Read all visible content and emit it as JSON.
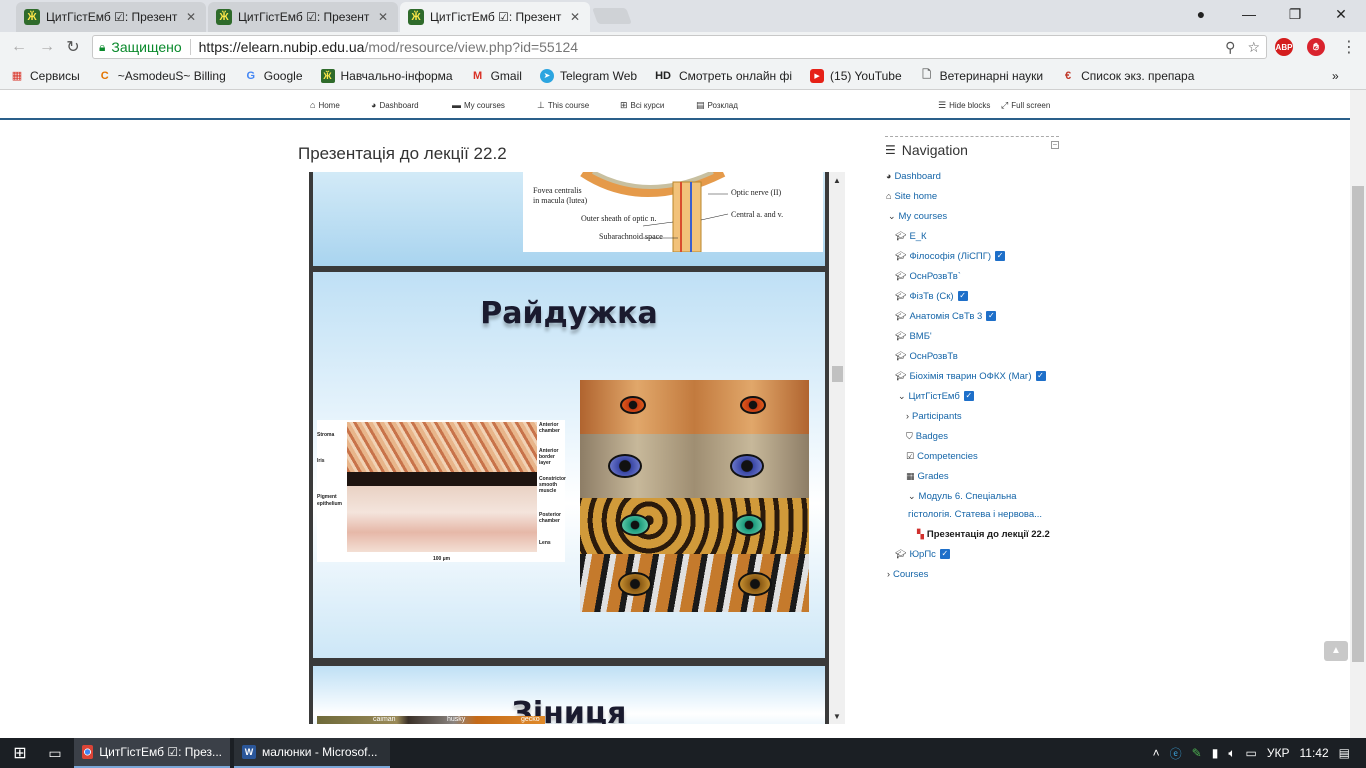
{
  "browser": {
    "tabs": [
      {
        "title": "ЦитГістЕмб ☑: Презент",
        "close": "✕"
      },
      {
        "title": "ЦитГістЕмб ☑: Презент",
        "close": "✕"
      },
      {
        "title": "ЦитГістЕмб ☑: Презент",
        "close": "✕"
      }
    ],
    "window_controls": {
      "minimize": "—",
      "restore": "❐",
      "close": "✕"
    },
    "address": {
      "secure_label": "Защищено",
      "url_scheme_host": "https://elearn.nubip.edu.ua",
      "url_path": "/mod/resource/view.php?id=55124"
    },
    "bookmarks": [
      {
        "label": "Сервисы"
      },
      {
        "label": "~AsmodeuS~ Billing"
      },
      {
        "label": "Google"
      },
      {
        "label": "Навчально-інформа"
      },
      {
        "label": "Gmail"
      },
      {
        "label": "Telegram Web"
      },
      {
        "label": "Смотреть онлайн фі"
      },
      {
        "label": "(15) YouTube"
      },
      {
        "label": "Ветеринарні науки"
      },
      {
        "label": "Список экз. препара"
      }
    ],
    "bookmark_prefixes": {
      "hd": "HD"
    },
    "extensions": {
      "abp": "ABP"
    },
    "more": "»"
  },
  "moodle_nav": {
    "home": "Home",
    "dashboard": "Dashboard",
    "my_courses": "My courses",
    "this_course": "This course",
    "all_courses": "Всі курси",
    "schedule": "Розклад",
    "hide_blocks": "Hide blocks",
    "full_screen": "Full screen"
  },
  "page": {
    "title": "Презентація до лекції 22.2"
  },
  "slides": {
    "slide1_labels": {
      "fovea": "Fovea centralis",
      "macula": "in macula (lutea)",
      "optic_nerve": "Optic nerve (II)",
      "outer_sheath": "Outer sheath of optic n.",
      "central": "Central a. and v.",
      "subarachnoid": "Subarachnoid space"
    },
    "slide2_heading": "Райдужка",
    "histo_labels": {
      "stroma": "Stroma",
      "iris": "Iris",
      "pigment": "Pigment",
      "epithelium": "epithelium",
      "anterior_chamber": "Anterior chamber",
      "anterior_border": "Anterior border layer",
      "constrictor": "Constrictor smooth muscle",
      "posterior": "Posterior chamber",
      "lens": "Lens",
      "scale": "100 µm"
    },
    "slide3_heading": "Зіниця",
    "slide3_labels": {
      "caiman": "caiman",
      "husky": "husky",
      "gecko": "gecko"
    }
  },
  "navigation": {
    "header": "Navigation",
    "items": [
      {
        "label": "Dashboard"
      },
      {
        "label": "Site home"
      },
      {
        "label": "My courses"
      },
      {
        "label": "Е_К"
      },
      {
        "label": "Філософія (ЛіСПГ)"
      },
      {
        "label": "ОснРозвТв`"
      },
      {
        "label": "ФізТв (Ск)"
      },
      {
        "label": "Анатомія СвТв 3"
      },
      {
        "label": "ВМБ'"
      },
      {
        "label": "ОснРозвТв"
      },
      {
        "label": "Біохімія тварин ОФКХ (Маг)"
      },
      {
        "label": "ЦитГістЕмб"
      },
      {
        "label": "Participants"
      },
      {
        "label": "Badges"
      },
      {
        "label": "Competencies"
      },
      {
        "label": "Grades"
      },
      {
        "label": "Модуль 6. Спеціальна"
      },
      {
        "label": "гістологія. Статева і нервова..."
      },
      {
        "label": "Презентація до лекції 22.2"
      },
      {
        "label": "ЮрПс"
      },
      {
        "label": "Courses"
      }
    ]
  },
  "taskbar": {
    "tasks": [
      {
        "label": "ЦитГістЕмб ☑: През..."
      },
      {
        "label": "малюнки - Microsof..."
      }
    ],
    "keyboard": "УКР",
    "time": "11:42"
  },
  "colors": {
    "moodle_accent": "#2a5f8a",
    "link": "#1565a8",
    "secure_green": "#0a8a2c",
    "checkbox_blue": "#1e6fc9"
  }
}
